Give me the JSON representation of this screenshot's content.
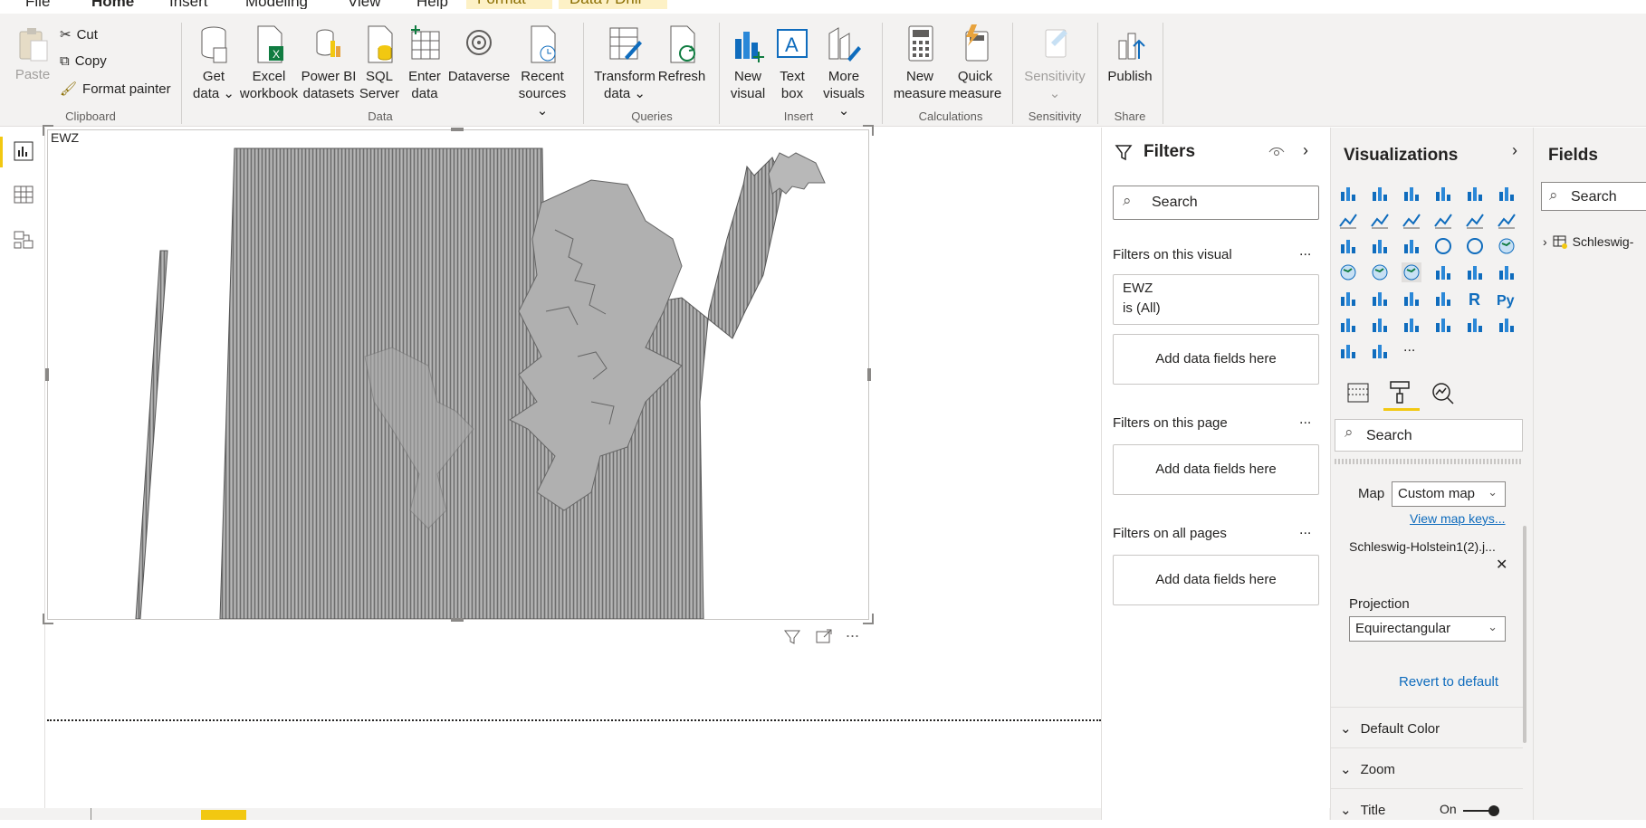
{
  "menu": {
    "tabs": [
      "File",
      "Home",
      "Insert",
      "Modeling",
      "View",
      "Help"
    ],
    "context_tabs": [
      "Format",
      "Data / Drill"
    ]
  },
  "ribbon": {
    "clipboard": {
      "paste": "Paste",
      "cut": "Cut",
      "copy": "Copy",
      "format_painter": "Format painter",
      "label": "Clipboard"
    },
    "data": {
      "get_data": [
        "Get",
        "data"
      ],
      "excel": [
        "Excel",
        "workbook"
      ],
      "powerbi": [
        "Power BI",
        "datasets"
      ],
      "sql": [
        "SQL",
        "Server"
      ],
      "enter": [
        "Enter",
        "data"
      ],
      "dataverse": "Dataverse",
      "recent": [
        "Recent",
        "sources"
      ],
      "label": "Data"
    },
    "queries": {
      "transform": [
        "Transform",
        "data"
      ],
      "refresh": "Refresh",
      "label": "Queries"
    },
    "insert": {
      "new_visual": [
        "New",
        "visual"
      ],
      "text_box": [
        "Text",
        "box"
      ],
      "more": [
        "More",
        "visuals"
      ],
      "label": "Insert"
    },
    "calculations": {
      "new_measure": [
        "New",
        "measure"
      ],
      "quick_measure": [
        "Quick",
        "measure"
      ],
      "label": "Calculations"
    },
    "sensitivity": {
      "btn": "Sensitivity",
      "label": "Sensitivity"
    },
    "share": {
      "publish": "Publish",
      "label": "Share"
    }
  },
  "visual": {
    "title": "EWZ"
  },
  "filters": {
    "title": "Filters",
    "search_placeholder": "Search",
    "on_visual": "Filters on this visual",
    "card_field": "EWZ",
    "card_value": "is (All)",
    "add_fields": "Add data fields here",
    "on_page": "Filters on this page",
    "on_all": "Filters on all pages",
    "more": "..."
  },
  "viz": {
    "title": "Visualizations",
    "search_placeholder": "Search",
    "map_label": "Map",
    "map_value": "Custom map",
    "view_keys": "View map keys...",
    "map_file": "Schleswig-Holstein1(2).j...",
    "projection_label": "Projection",
    "projection_value": "Equirectangular",
    "revert": "Revert to default",
    "default_color": "Default Color",
    "zoom": "Zoom",
    "title_section": "Title",
    "toggle_on": "On",
    "more": "..."
  },
  "fields": {
    "title": "Fields",
    "search_placeholder": "Search",
    "table": "Schleswig-"
  },
  "colors": {
    "accent": "#f2c811",
    "link": "#0f6cbd",
    "map_fill": "#a0a0a0",
    "map_stroke": "#555555"
  }
}
